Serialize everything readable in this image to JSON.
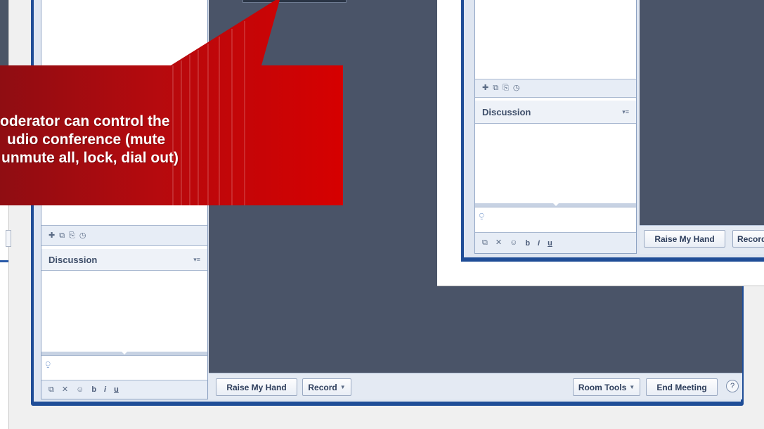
{
  "callout": {
    "lines": [
      "oderator can control the",
      "udio conference (mute",
      "unmute all, lock, dial out)"
    ]
  },
  "main_window": {
    "left_panel": {
      "discussion_title": "Discussion",
      "format_bold": "b",
      "format_italic": "i",
      "format_underline": "u"
    },
    "bottom_bar": {
      "raise_hand_label": "Raise My Hand",
      "record_label": "Record",
      "room_tools_label": "Room Tools",
      "end_meeting_label": "End Meeting",
      "help_label": "?"
    }
  },
  "overlay_window": {
    "left_panel": {
      "discussion_title": "Discussion",
      "format_bold": "b",
      "format_italic": "i",
      "format_underline": "u"
    },
    "bottom_bar": {
      "raise_hand_label": "Raise My Hand",
      "record_label": "Record"
    }
  },
  "icons": {
    "toolbar": [
      "add-icon",
      "copy-icon",
      "paste-icon",
      "history-icon"
    ],
    "chat": [
      "copy-text-icon",
      "clear-icon",
      "emoticon-icon"
    ],
    "dropdown_caret": "▼",
    "panel_menu": "▾≡"
  },
  "colors": {
    "callout_red": "#cc0000",
    "callout_dark_red": "#8f0d12",
    "window_frame": "#1f4d97",
    "stage": "#4a5468"
  }
}
